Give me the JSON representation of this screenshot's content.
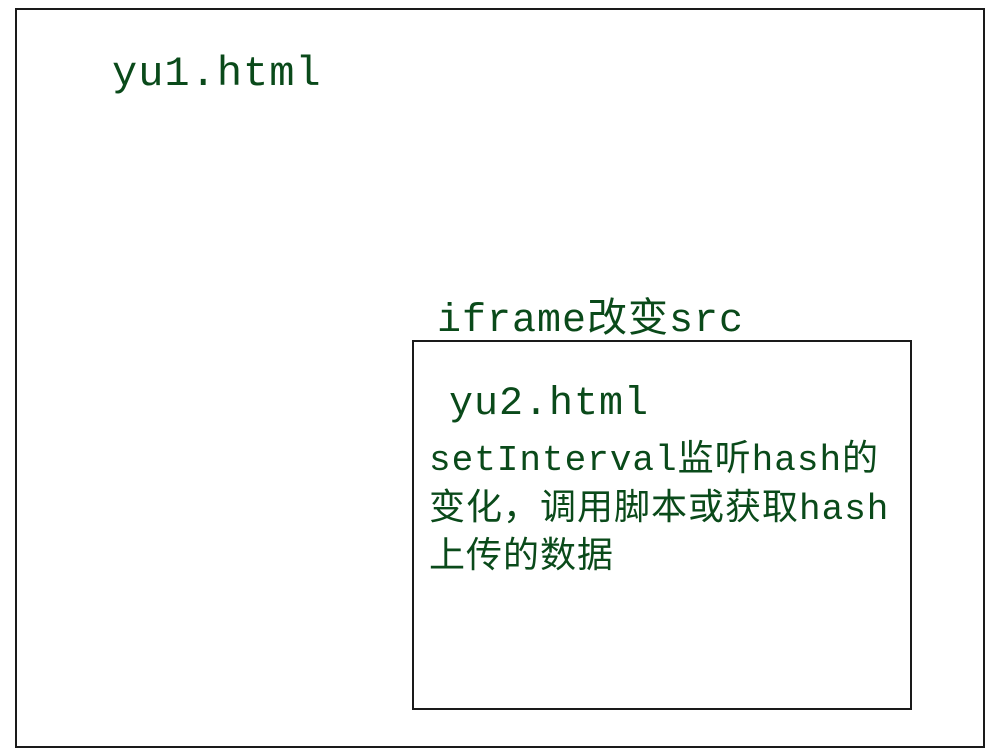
{
  "outer": {
    "title": "yu1.html"
  },
  "iframe_label": "iframe改变src",
  "inner": {
    "title": "yu2.html",
    "description": "setInterval监听hash的变化，调用脚本或获取hash上传的数据"
  }
}
